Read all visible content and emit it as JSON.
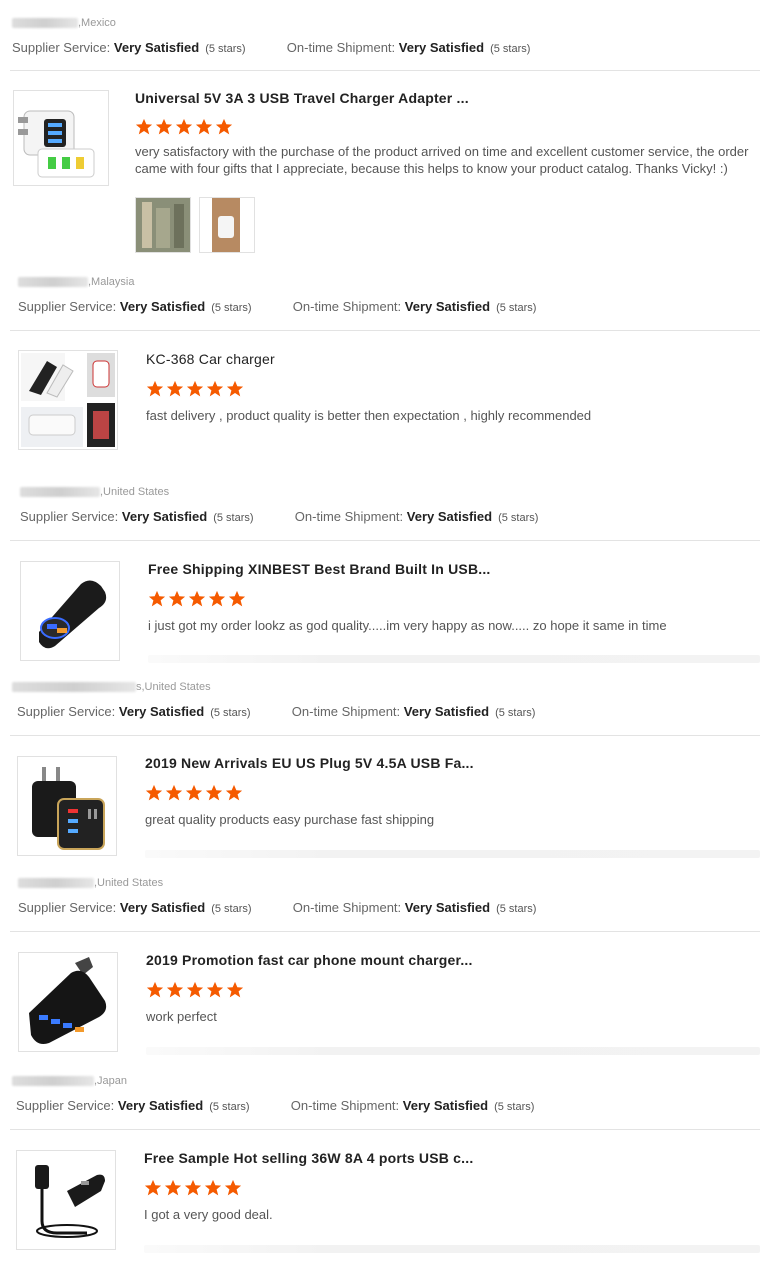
{
  "colors": {
    "star": "#f55a00",
    "divider": "#e3e3e3",
    "label": "#666666",
    "value": "#222222"
  },
  "ratings": {
    "supplier_label": "Supplier Service:",
    "shipment_label": "On-time Shipment:",
    "value": "Very Satisfied",
    "stars_note": "(5 stars)"
  },
  "reviews": [
    {
      "buyer_country": ",Mexico",
      "product_title": "",
      "review_text": ""
    },
    {
      "buyer_country": ",Malaysia",
      "product_title": "Universal 5V 3A 3 USB Travel Charger Adapter ...",
      "rating": 5,
      "review_text": "very satisfactory with the purchase of the product arrived on time and excellent customer service, the order came with four gifts that I appreciate, because this helps to know your product catalog. Thanks Vicky! :)",
      "photos": [
        "review-photo-1",
        "review-photo-2"
      ]
    },
    {
      "buyer_country": ",United States",
      "product_title": "KC-368 Car charger",
      "rating": 5,
      "review_text": "fast delivery , product quality is better then expectation , highly recommended"
    },
    {
      "buyer_country": "s,United States",
      "product_title": "Free Shipping XINBEST Best Brand Built In USB...",
      "rating": 5,
      "review_text": "i just got my order lookz as god quality.....im very happy as now..... zo hope it same in time"
    },
    {
      "buyer_country": ",United States",
      "product_title": "2019 New Arrivals EU US Plug 5V 4.5A USB Fa...",
      "rating": 5,
      "review_text": "great quality products easy purchase fast shipping"
    },
    {
      "buyer_country": ",Japan",
      "product_title": "2019 Promotion fast car phone mount charger...",
      "rating": 5,
      "review_text": "work perfect"
    },
    {
      "buyer_country": "",
      "product_title": "Free Sample Hot selling 36W 8A 4 ports USB c...",
      "rating": 5,
      "review_text": "I got a very good deal."
    }
  ]
}
